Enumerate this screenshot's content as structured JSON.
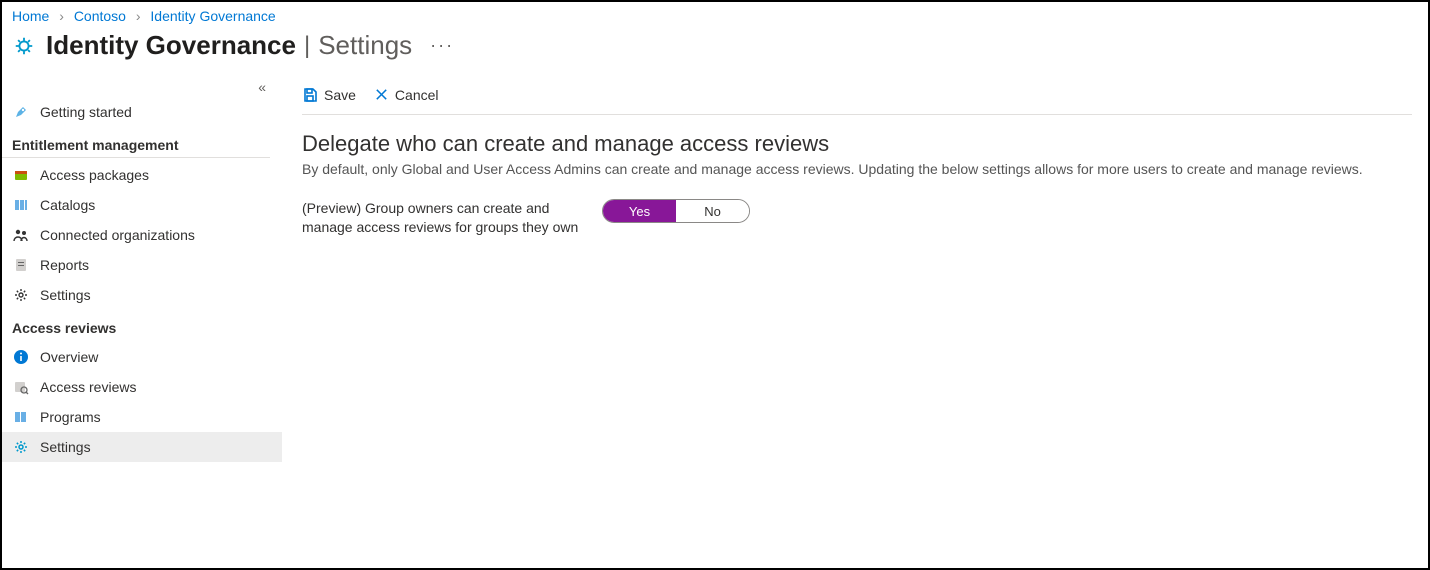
{
  "breadcrumb": {
    "items": [
      {
        "label": "Home"
      },
      {
        "label": "Contoso"
      },
      {
        "label": "Identity Governance"
      }
    ]
  },
  "header": {
    "title_main": "Identity Governance",
    "title_sub": "Settings"
  },
  "toolbar": {
    "save_label": "Save",
    "cancel_label": "Cancel"
  },
  "sidebar": {
    "getting_started": "Getting started",
    "section_entitlement": "Entitlement management",
    "items_ent": [
      {
        "label": "Access packages"
      },
      {
        "label": "Catalogs"
      },
      {
        "label": "Connected organizations"
      },
      {
        "label": "Reports"
      },
      {
        "label": "Settings"
      }
    ],
    "section_access": "Access reviews",
    "items_ar": [
      {
        "label": "Overview"
      },
      {
        "label": "Access reviews"
      },
      {
        "label": "Programs"
      },
      {
        "label": "Settings"
      }
    ]
  },
  "content": {
    "section_title": "Delegate who can create and manage access reviews",
    "section_desc": "By default, only Global and User Access Admins can create and manage access reviews. Updating the below settings allows for more users to create and manage reviews.",
    "setting_label": "(Preview) Group owners can create and manage access reviews for groups they own",
    "toggle_yes": "Yes",
    "toggle_no": "No",
    "toggle_value": "Yes"
  }
}
